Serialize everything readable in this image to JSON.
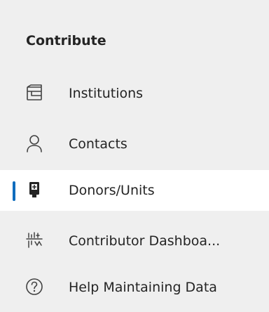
{
  "nav": {
    "section_title": "Contribute",
    "accent_color": "#0f6cbd",
    "items": [
      {
        "label": "Institutions",
        "icon": "institution-icon"
      },
      {
        "label": "Contacts",
        "icon": "person-icon"
      },
      {
        "label": "Donors/Units",
        "icon": "donor-unit-icon",
        "selected": true
      },
      {
        "label": "Contributor Dashboa...",
        "icon": "dashboard-icon"
      },
      {
        "label": "Help Maintaining Data",
        "icon": "help-icon"
      }
    ]
  }
}
